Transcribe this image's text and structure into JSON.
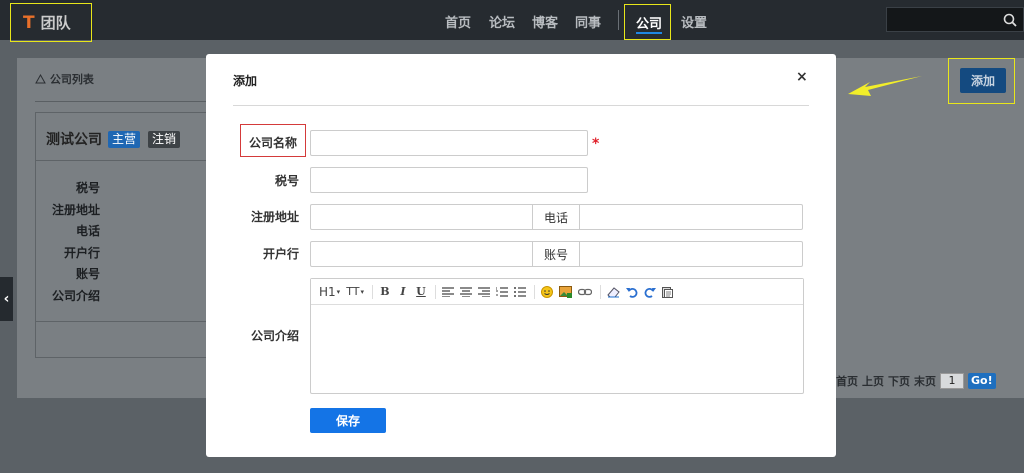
{
  "app": {
    "logo_letter": "T",
    "title": "团队"
  },
  "nav": {
    "items": [
      "首页",
      "论坛",
      "博客",
      "同事"
    ],
    "active": "公司",
    "settings": "设置"
  },
  "search": {
    "placeholder": "",
    "icon": "search-icon"
  },
  "panel": {
    "title": "公司列表"
  },
  "company": {
    "name": "测试公司",
    "badge_main": "主营",
    "badge_cancel": "注销",
    "fields": [
      "税号",
      "注册地址",
      "电话",
      "开户行",
      "账号",
      "公司介绍"
    ]
  },
  "add_button": "添加",
  "pager": {
    "first": "首页",
    "prev": "上页",
    "next": "下页",
    "last": "末页",
    "page": "1",
    "go": "Go!"
  },
  "modal": {
    "title": "添加",
    "close": "×",
    "fields": {
      "company_name": "公司名称",
      "tax_no": "税号",
      "reg_address": "注册地址",
      "phone": "电话",
      "bank": "开户行",
      "account": "账号",
      "intro": "公司介绍"
    },
    "required_mark": "*",
    "toolbar": {
      "heading": "H1",
      "font_size": "TT",
      "bold": "B",
      "italic": "I",
      "underline": "U"
    },
    "save": "保存"
  },
  "colors": {
    "accent": "#1474e6",
    "highlight": "#e8e61a",
    "required": "#d43a3a"
  }
}
